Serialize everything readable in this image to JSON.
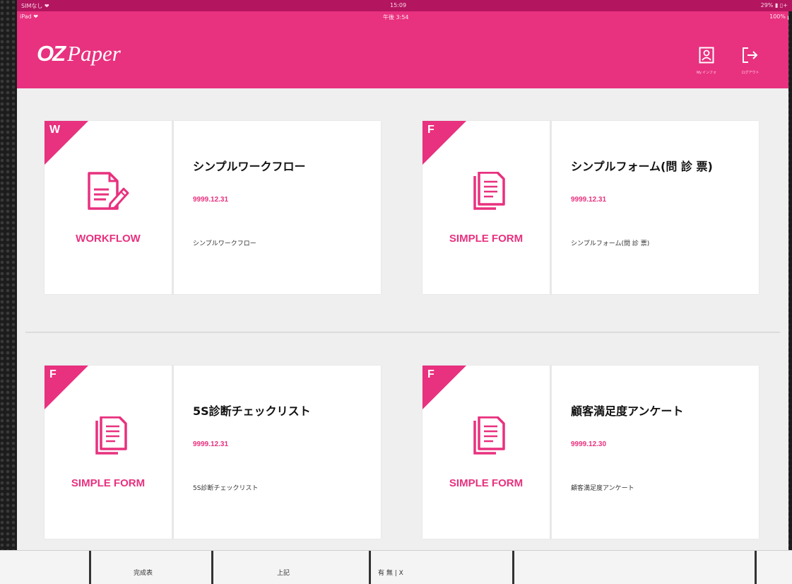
{
  "status_outer": {
    "carrier": "SIMなし ❤",
    "time": "15:09",
    "battery": "29% ▮ ▯+"
  },
  "status_inner": {
    "device": "iPad ❤",
    "time": "午後 3:54",
    "battery": "100%"
  },
  "header": {
    "logo_oz": "OZ",
    "logo_paper": "Paper",
    "my_info_label": "My インフォ",
    "logout_label": "ログアウト",
    "accent_color": "#e8317f"
  },
  "cards": [
    {
      "corner": "W",
      "icon": "workflow-document-pencil-icon",
      "type_label": "WORKFLOW",
      "title": "シンプルワークフロー",
      "date": "9999.12.31",
      "desc": "シンプルワークフロー"
    },
    {
      "corner": "F",
      "icon": "simple-form-document-icon",
      "type_label": "SIMPLE FORM",
      "title": "シンプルフォーム(問 診 票)",
      "date": "9999.12.31",
      "desc": "シンプルフォーム(問 診 票)"
    },
    {
      "corner": "F",
      "icon": "simple-form-document-icon",
      "type_label": "SIMPLE FORM",
      "title": "5S診断チェックリスト",
      "date": "9999.12.31",
      "desc": "5S診断チェックリスト"
    },
    {
      "corner": "F",
      "icon": "simple-form-document-icon",
      "type_label": "SIMPLE FORM",
      "title": "顧客満足度アンケート",
      "date": "9999.12.30",
      "desc": "顧客満足度アンケート"
    }
  ],
  "background_strip": {
    "cell_a": "完成表",
    "cell_b": "上記",
    "cell_c": "有  無 | X"
  }
}
